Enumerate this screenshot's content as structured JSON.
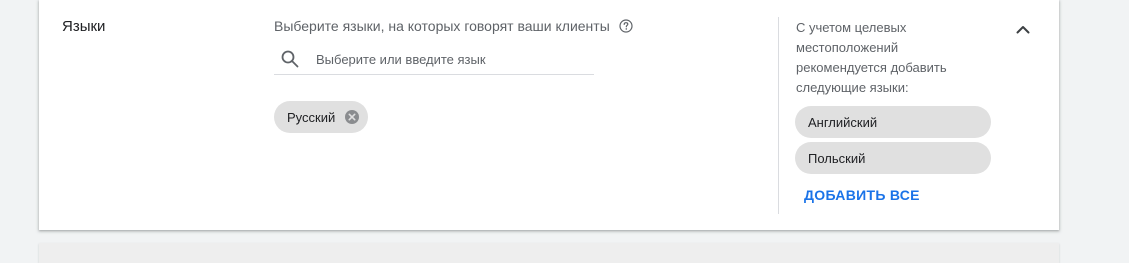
{
  "section": {
    "title": "Языки",
    "prompt": "Выберите языки, на которых говорят ваши клиенты"
  },
  "search": {
    "placeholder": "Выберите или введите язык",
    "value": ""
  },
  "selected_languages": [
    {
      "label": "Русский"
    }
  ],
  "suggestions": {
    "hint": "С учетом целевых местоположений рекомендуется добавить следующие языки:",
    "items": [
      {
        "label": "Английский"
      },
      {
        "label": "Польский"
      }
    ],
    "add_all_label": "ДОБАВИТЬ ВСЕ"
  },
  "icons": {
    "help": "help-circle-icon",
    "search": "search-icon",
    "chip_remove": "close-circle-icon",
    "collapse": "chevron-up-icon"
  },
  "colors": {
    "accent": "#1a73e8",
    "chip_background": "#e0e0e0",
    "text_primary": "#202124",
    "text_secondary": "#5f6368"
  }
}
